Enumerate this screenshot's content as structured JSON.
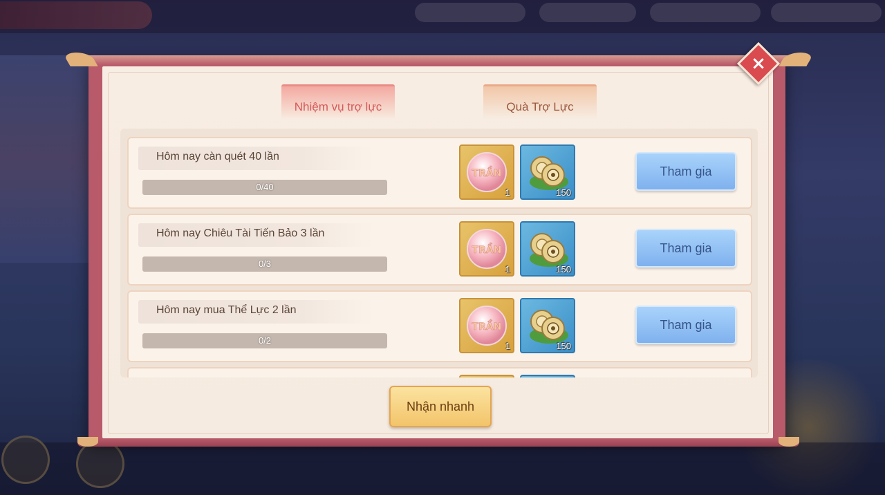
{
  "tabs": [
    {
      "label": "Nhiệm vụ trợ lực",
      "active": true
    },
    {
      "label": "Quà Trợ Lực",
      "active": false
    }
  ],
  "tasks": [
    {
      "title": "Hôm nay càn quét 40 lần",
      "progress_text": "0/40",
      "progress": 0,
      "rewards": [
        {
          "icon": "tran-pearl-icon",
          "count": "1"
        },
        {
          "icon": "fruit-icon",
          "count": "150"
        }
      ],
      "action": "Tham gia"
    },
    {
      "title": "Hôm nay Chiêu Tài Tiến Bảo 3 lần",
      "progress_text": "0/3",
      "progress": 0,
      "rewards": [
        {
          "icon": "tran-pearl-icon",
          "count": "1"
        },
        {
          "icon": "fruit-icon",
          "count": "150"
        }
      ],
      "action": "Tham gia"
    },
    {
      "title": "Hôm nay mua Thể Lực 2 lần",
      "progress_text": "0/2",
      "progress": 0,
      "rewards": [
        {
          "icon": "tran-pearl-icon",
          "count": "1"
        },
        {
          "icon": "fruit-icon",
          "count": "150"
        }
      ],
      "action": "Tham gia"
    }
  ],
  "pearl_text": "TRẦN",
  "quick_claim": "Nhận nhanh",
  "close_symbol": "×",
  "colors": {
    "frame": "#b95a6a",
    "panel": "#f8ede3",
    "tab_active_text": "#d35a5a",
    "join_button": "#7fb1ee",
    "quick_button": "#f3c46a"
  }
}
